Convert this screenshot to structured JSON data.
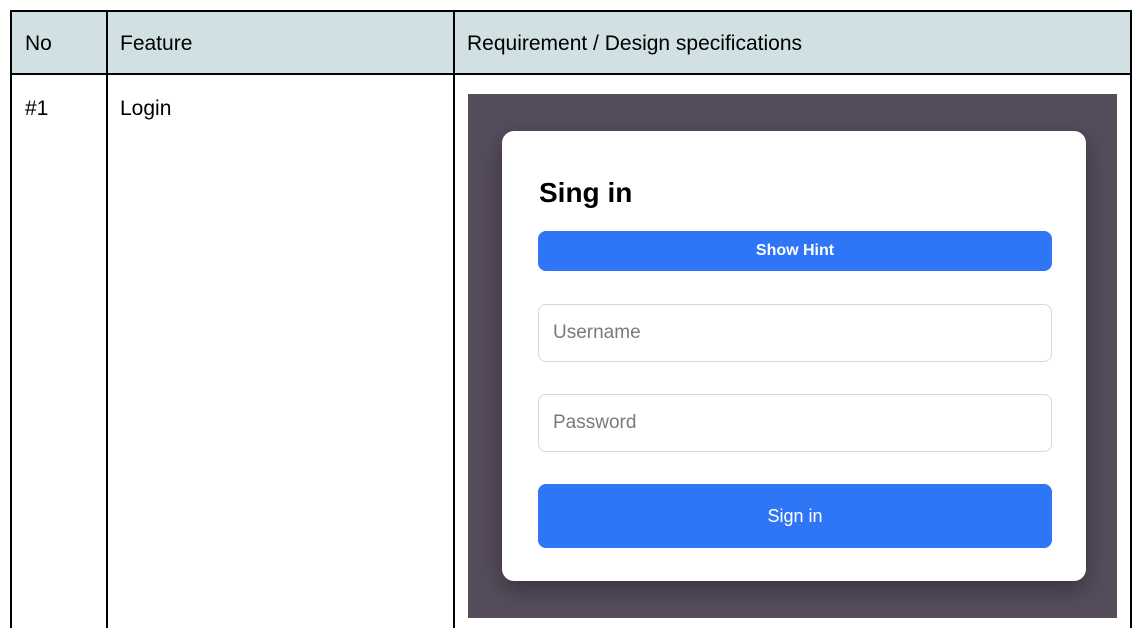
{
  "table": {
    "headers": [
      "No",
      "Feature",
      "Requirement / Design specifications"
    ],
    "rows": [
      {
        "no": "#1",
        "feature": "Login"
      }
    ],
    "header_bg": "#d0e0e3"
  },
  "mockup": {
    "title": "Sing in",
    "hint_button": "Show Hint",
    "username_placeholder": "Username",
    "password_placeholder": "Password",
    "signin_button": "Sign in",
    "accent": "#2f76f6",
    "backdrop": "#554c5c"
  }
}
